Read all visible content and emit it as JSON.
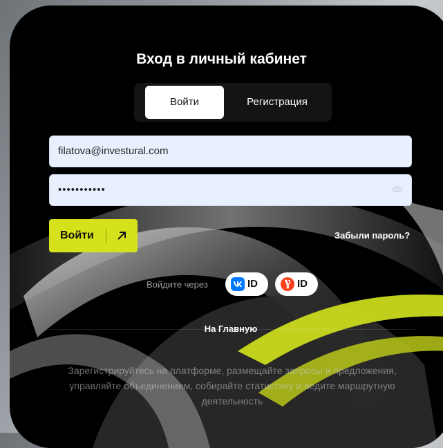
{
  "title": "Вход в личный кабинет",
  "tabs": [
    {
      "label": "Войти",
      "active": true
    },
    {
      "label": "Регистрация",
      "active": false
    }
  ],
  "form": {
    "email_value": "filatova@investural.com",
    "password_value": "•••••••••••"
  },
  "buttons": {
    "login_label": "Войти",
    "forgot_label": "Забыли пароль?"
  },
  "social": {
    "via_label": "Войдите через",
    "vk_id": "ID",
    "ya_id": "ID",
    "vk_icon": "vk-logo-icon",
    "ya_icon": "yandex-logo-icon"
  },
  "home_link": "На Главную",
  "description": "Зарегистрируйтесь на платформе, размещайте запросы и предложения, управляйте объединением, собирайте статистику и ведите маршрутную деятельность",
  "colors": {
    "accent": "#d5e11a",
    "card": "#000000",
    "input_bg": "#e9f0fd"
  }
}
